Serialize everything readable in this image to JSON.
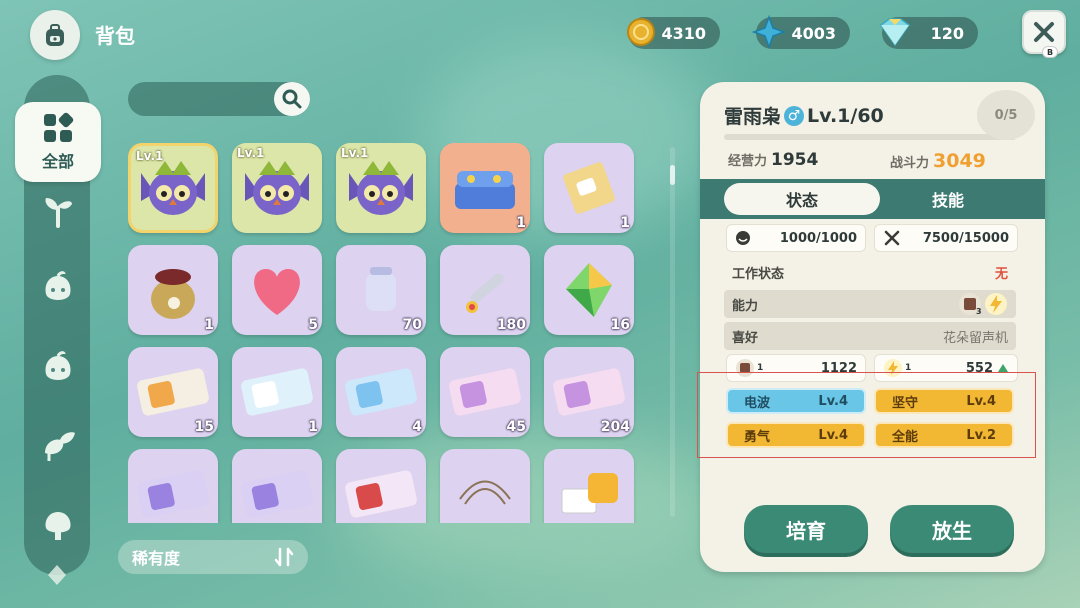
{
  "header": {
    "title": "背包",
    "currencies": [
      {
        "name": "gold-coin",
        "value": "4310",
        "color": "#e8b22e"
      },
      {
        "name": "blue-star",
        "value": "4003",
        "color": "#3fb0d8"
      },
      {
        "name": "crystal",
        "value": "120",
        "color": "#7fd8e6"
      }
    ],
    "close_key": "B"
  },
  "sidebar": {
    "items": [
      {
        "label": "全部",
        "icon": "grid-icon",
        "active": true
      },
      {
        "icon": "sprout-icon"
      },
      {
        "icon": "seed-face-icon"
      },
      {
        "icon": "seed-face-icon"
      },
      {
        "icon": "leaf-bud-icon"
      },
      {
        "icon": "tree-icon"
      }
    ]
  },
  "search": {
    "placeholder": ""
  },
  "grid": {
    "items": [
      {
        "type": "owl",
        "level": "Lv.1",
        "count": "",
        "bg": "green",
        "selected": true
      },
      {
        "type": "owl",
        "level": "Lv.1",
        "count": "",
        "bg": "green"
      },
      {
        "type": "owl",
        "level": "Lv.1",
        "count": "",
        "bg": "green"
      },
      {
        "type": "bed",
        "level": "",
        "count": "1",
        "bg": "orange"
      },
      {
        "type": "box",
        "level": "",
        "count": "1",
        "bg": "purple"
      },
      {
        "type": "sack",
        "level": "",
        "count": "1",
        "bg": "purple"
      },
      {
        "type": "heart",
        "level": "",
        "count": "5",
        "bg": "purple"
      },
      {
        "type": "jar",
        "level": "",
        "count": "70",
        "bg": "purple"
      },
      {
        "type": "tool",
        "level": "",
        "count": "180",
        "bg": "purple"
      },
      {
        "type": "gem",
        "level": "",
        "count": "16",
        "bg": "purple"
      },
      {
        "type": "ticket-cat",
        "level": "",
        "count": "15",
        "bg": "purple"
      },
      {
        "type": "ticket-cloud",
        "level": "",
        "count": "1",
        "bg": "purple"
      },
      {
        "type": "ticket-blue",
        "level": "",
        "count": "4",
        "bg": "purple"
      },
      {
        "type": "ticket-pink",
        "level": "",
        "count": "45",
        "bg": "purple"
      },
      {
        "type": "ticket-pink",
        "level": "",
        "count": "204",
        "bg": "purple"
      },
      {
        "type": "ticket-violet",
        "level": "",
        "count": "",
        "bg": "purple"
      },
      {
        "type": "ticket-violet",
        "level": "",
        "count": "",
        "bg": "purple"
      },
      {
        "type": "ticket-red",
        "level": "",
        "count": "",
        "bg": "purple"
      },
      {
        "type": "wire",
        "level": "",
        "count": "",
        "bg": "purple"
      },
      {
        "type": "piano",
        "level": "",
        "count": "",
        "bg": "purple"
      }
    ],
    "scroll_fraction": 0.05
  },
  "sort": {
    "label": "稀有度"
  },
  "panel": {
    "name": "雷雨枭",
    "gender": "♂",
    "level": "Lv.1/60",
    "exp_fraction": 0,
    "slots": "0/5",
    "business_label": "经营力",
    "business_value": "1954",
    "combat_label": "战斗力",
    "combat_value": "3049",
    "tabs": [
      {
        "label": "状态",
        "active": true
      },
      {
        "label": "技能",
        "active": false
      }
    ],
    "hunger": "1000/1000",
    "stamina": "7500/15000",
    "work_label": "工作状态",
    "work_value": "无",
    "ability_label": "能力",
    "ability_badge_level": "3",
    "likes_label": "喜好",
    "likes_value": "花朵留声机",
    "attr_left_value": "1122",
    "attr_left_level": "1",
    "attr_right_value": "552",
    "attr_right_level": "1",
    "skills": [
      {
        "name": "电波",
        "level": "Lv.4",
        "color": "blue"
      },
      {
        "name": "坚守",
        "level": "Lv.4",
        "color": "gold"
      },
      {
        "name": "勇气",
        "level": "Lv.4",
        "color": "gold"
      },
      {
        "name": "全能",
        "level": "Lv.2",
        "color": "gold"
      }
    ],
    "buttons": {
      "breed": "培育",
      "release": "放生"
    }
  }
}
